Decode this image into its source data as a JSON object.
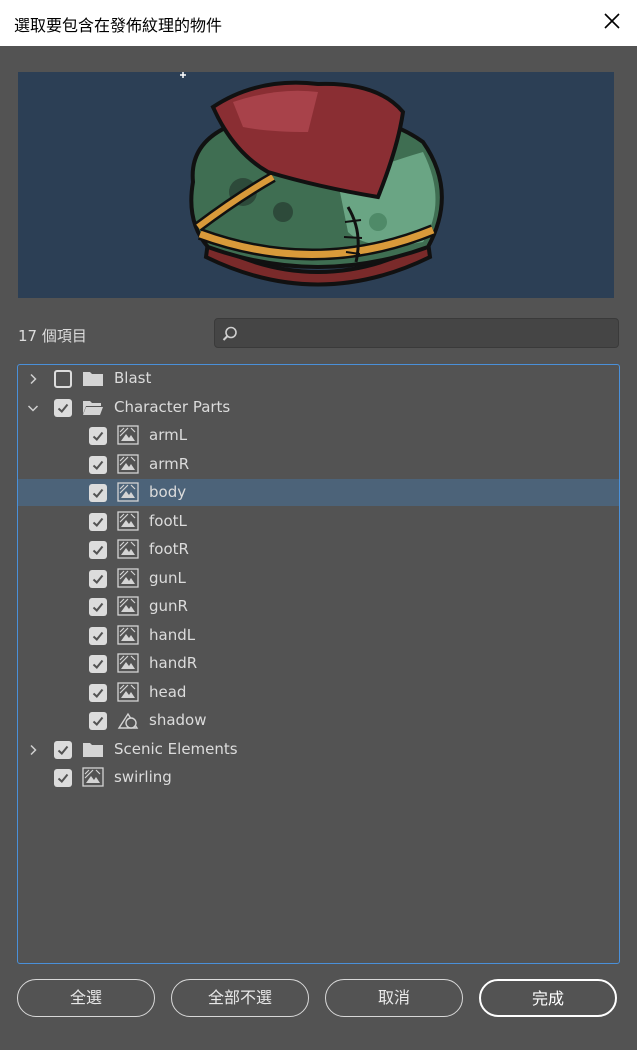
{
  "dialog": {
    "title": "選取要包含在發佈紋理的物件",
    "item_count": "17 個項目",
    "search_placeholder": ""
  },
  "tree": {
    "items": [
      {
        "label": "Blast",
        "type": "folder",
        "expanded": false,
        "checked": false,
        "indent": 0,
        "selected": false
      },
      {
        "label": "Character Parts",
        "type": "folder-open",
        "expanded": true,
        "checked": true,
        "indent": 0,
        "selected": false
      },
      {
        "label": "armL",
        "type": "symbol",
        "checked": true,
        "indent": 1,
        "selected": false
      },
      {
        "label": "armR",
        "type": "symbol",
        "checked": true,
        "indent": 1,
        "selected": false
      },
      {
        "label": "body",
        "type": "symbol",
        "checked": true,
        "indent": 1,
        "selected": true
      },
      {
        "label": "footL",
        "type": "symbol",
        "checked": true,
        "indent": 1,
        "selected": false
      },
      {
        "label": "footR",
        "type": "symbol",
        "checked": true,
        "indent": 1,
        "selected": false
      },
      {
        "label": "gunL",
        "type": "symbol",
        "checked": true,
        "indent": 1,
        "selected": false
      },
      {
        "label": "gunR",
        "type": "symbol",
        "checked": true,
        "indent": 1,
        "selected": false
      },
      {
        "label": "handL",
        "type": "symbol",
        "checked": true,
        "indent": 1,
        "selected": false
      },
      {
        "label": "handR",
        "type": "symbol",
        "checked": true,
        "indent": 1,
        "selected": false
      },
      {
        "label": "head",
        "type": "symbol",
        "checked": true,
        "indent": 1,
        "selected": false
      },
      {
        "label": "shadow",
        "type": "shape",
        "checked": true,
        "indent": 1,
        "selected": false
      },
      {
        "label": "Scenic Elements",
        "type": "folder",
        "expanded": false,
        "checked": true,
        "indent": 0,
        "selected": false
      },
      {
        "label": "swirling",
        "type": "symbol",
        "checked": true,
        "indent": 0,
        "selected": false
      }
    ]
  },
  "buttons": {
    "select_all": "全選",
    "deselect_all": "全部不選",
    "cancel": "取消",
    "done": "完成"
  },
  "colors": {
    "background": "#535353",
    "preview_bg": "#2c3f55",
    "selection": "#4c6379",
    "focus_border": "#4a90d9"
  }
}
